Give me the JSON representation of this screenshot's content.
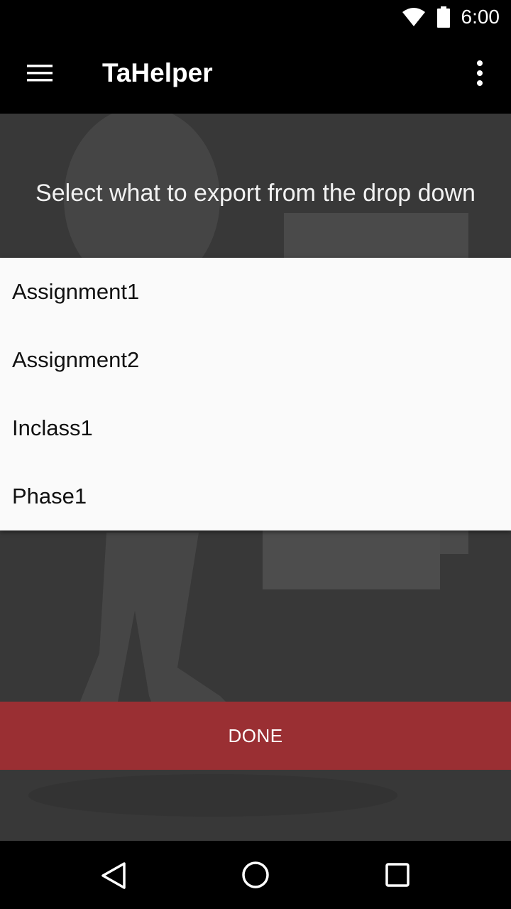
{
  "status_bar": {
    "time": "6:00",
    "icons": [
      "wifi-icon",
      "battery-icon"
    ]
  },
  "app_bar": {
    "title": "TaHelper",
    "icons": [
      "menu-icon",
      "overflow-menu-icon"
    ]
  },
  "main": {
    "instruction": "Select what to export from the drop down",
    "dropdown": {
      "items": [
        {
          "label": "Assignment1"
        },
        {
          "label": "Assignment2"
        },
        {
          "label": "Inclass1"
        },
        {
          "label": "Phase1"
        }
      ]
    },
    "done_label": "DONE"
  },
  "nav_bar": {
    "icons": [
      "back-icon",
      "home-icon",
      "recents-icon"
    ]
  },
  "colors": {
    "bars": "#000000",
    "background_overlay": "#3a3a3a",
    "dropdown_bg": "#fafafa",
    "done_button": "#9a2f33"
  }
}
